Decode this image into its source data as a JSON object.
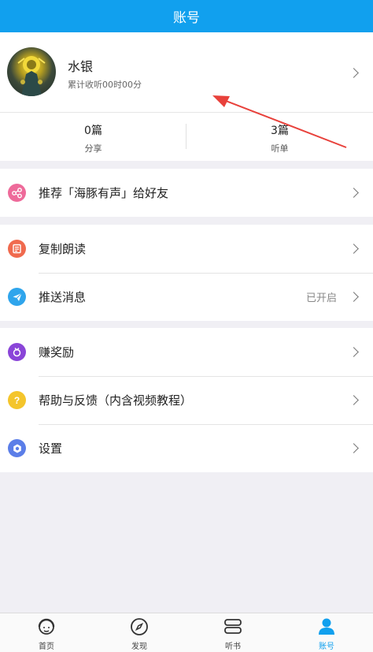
{
  "header": {
    "title": "账号"
  },
  "profile": {
    "name": "水银",
    "listen_time": "累计收听00时00分"
  },
  "stats": [
    {
      "value": "0篇",
      "label": "分享"
    },
    {
      "value": "3篇",
      "label": "听单"
    }
  ],
  "menu": {
    "recommend": {
      "label": "推荐「海豚有声」给好友"
    },
    "copy_read": {
      "label": "复制朗读"
    },
    "push": {
      "label": "推送消息",
      "status": "已开启"
    },
    "earn": {
      "label": "赚奖励"
    },
    "help": {
      "label": "帮助与反馈（内含视频教程）"
    },
    "settings": {
      "label": "设置"
    }
  },
  "tabbar": [
    {
      "label": "首页"
    },
    {
      "label": "发现"
    },
    {
      "label": "听书"
    },
    {
      "label": "账号"
    }
  ],
  "colors": {
    "accent": "#11a0ee",
    "annotation": "#e8413b"
  }
}
